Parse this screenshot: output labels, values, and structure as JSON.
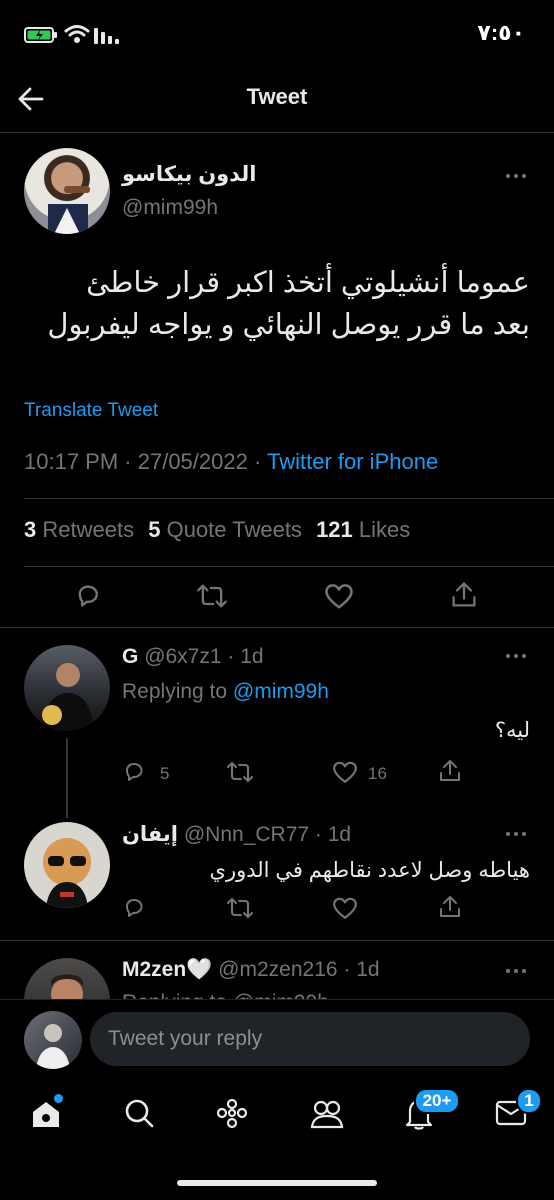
{
  "status_bar": {
    "time": "٧:٥٠"
  },
  "header": {
    "title": "Tweet"
  },
  "tweet": {
    "display_name": "الدون بيكاسو",
    "handle": "@mim99h",
    "text_line1": "عموما أنشيلوتي أتخذ اكبر قرار خاطئ",
    "text_line2": "بعد ما قرر يوصل النهائي و يواجه ليفربول",
    "translate": "Translate Tweet",
    "time": "10:17 PM",
    "date": "27/05/2022",
    "source": "Twitter for iPhone",
    "retweets_count": "3",
    "retweets_label": "Retweets",
    "quotes_count": "5",
    "quotes_label": "Quote Tweets",
    "likes_count": "121",
    "likes_label": "Likes"
  },
  "replies": [
    {
      "display_name": "G",
      "handle": "@6x7z1",
      "age": "1d",
      "replying_prefix": "Replying to",
      "replying_to": "@mim99h",
      "text": "ليه؟",
      "reply_count": "5",
      "like_count": "16"
    },
    {
      "display_name": "إيفان",
      "handle": "@Nnn_CR77",
      "age": "1d",
      "text": "هياطه وصل لاعدد نقاطهم في الدوري"
    },
    {
      "display_name": "M2zen🤍",
      "handle": "@m2zen216",
      "age": "1d",
      "replying_partial": "Replying to @mim99h"
    }
  ],
  "composer": {
    "placeholder": "Tweet your reply"
  },
  "tabbar": {
    "notifications_badge": "20+",
    "messages_badge": "1"
  },
  "colors": {
    "accent": "#1d9bf0",
    "background": "#000000",
    "muted": "#71767b",
    "text": "#e7e9ea"
  }
}
